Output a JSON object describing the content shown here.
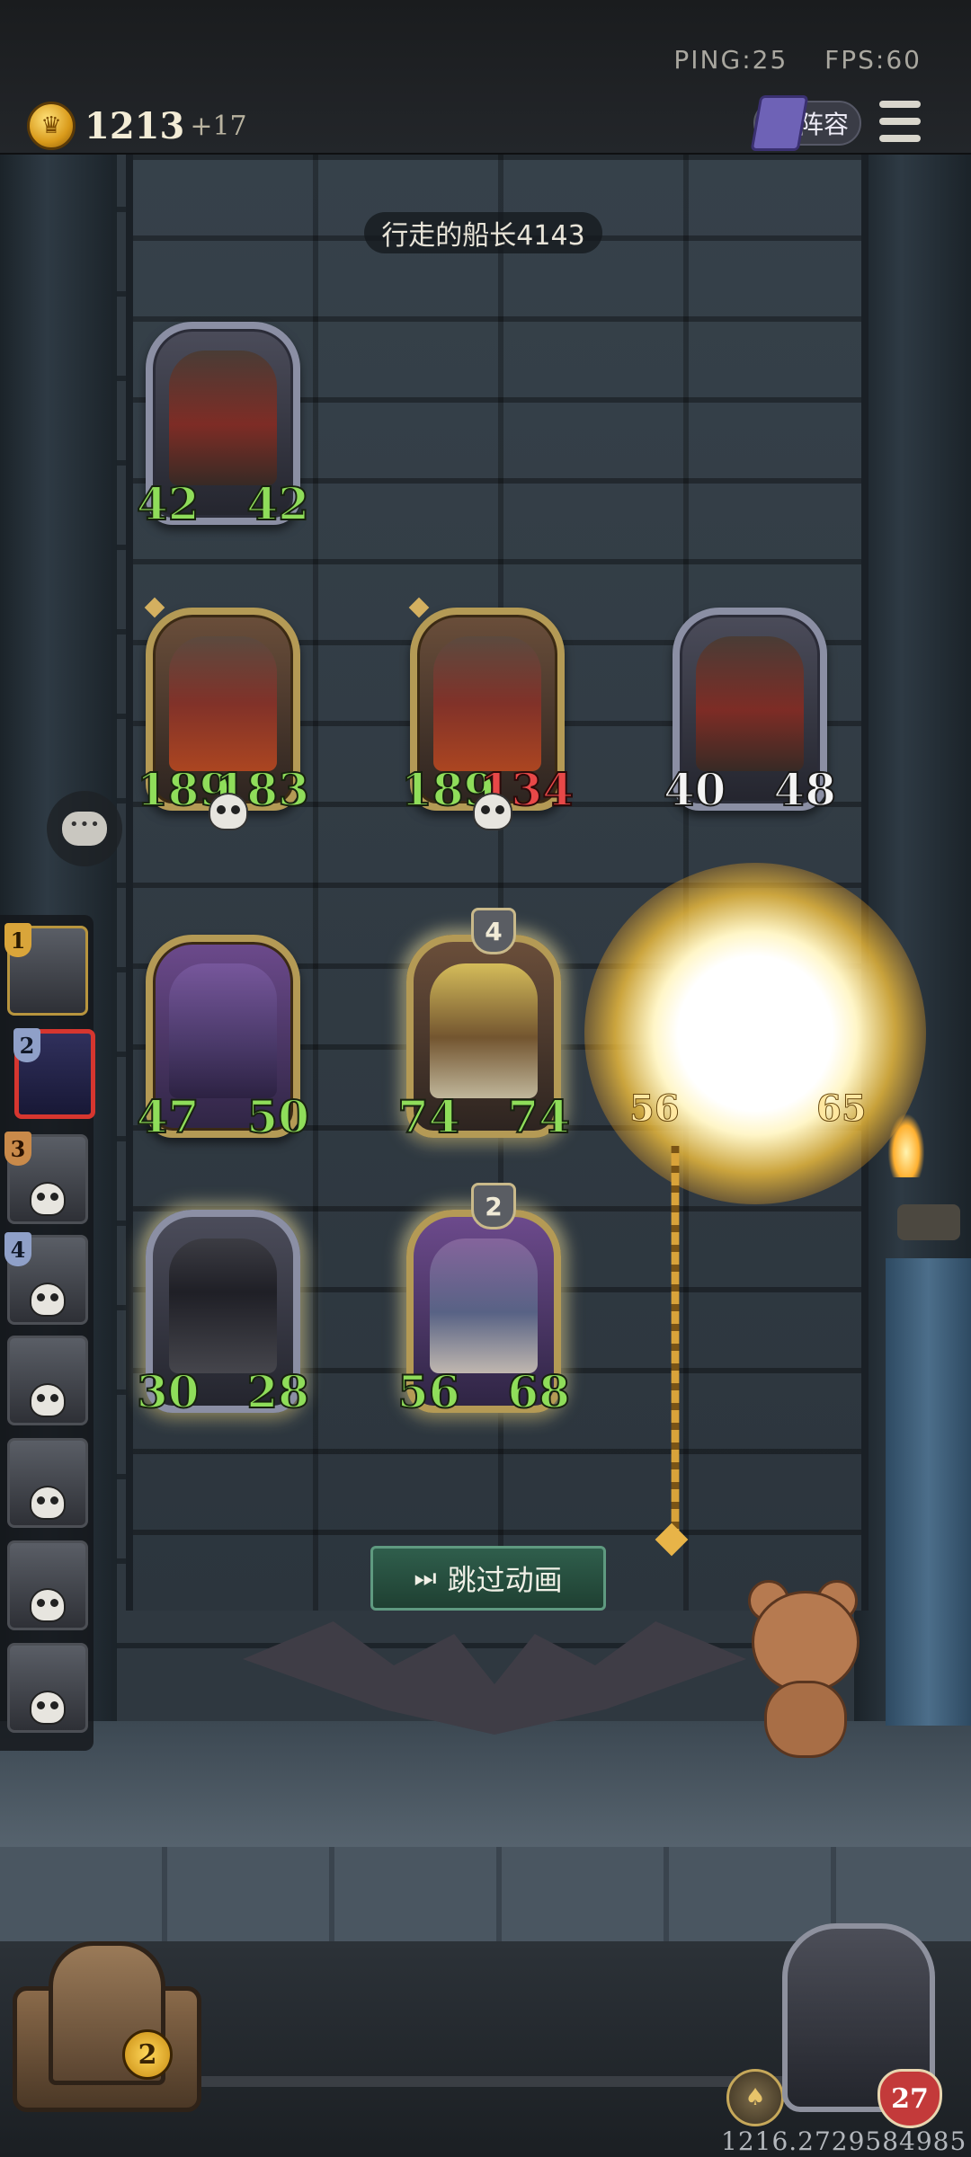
{
  "network": {
    "ping": "PING:25",
    "fps": "FPS:60"
  },
  "player": {
    "gold": "1213",
    "gold_income": "+17",
    "hero_health": "27"
  },
  "buttons": {
    "lineup": "阵容",
    "skip_animation": "跳过动画"
  },
  "opponent": {
    "name": "行走的船长4143"
  },
  "opponent_board": [
    {
      "attack": "42",
      "health": "42",
      "style": "silver",
      "tier": ""
    },
    {
      "attack": "189",
      "health": "183",
      "style": "gold",
      "tier": "",
      "dead": true
    },
    {
      "attack": "189",
      "health": "134",
      "style": "gold",
      "tier": "",
      "dead": true,
      "damaged": true
    },
    {
      "attack": "40",
      "health": "48",
      "style": "silver",
      "tier": ""
    }
  ],
  "player_board": [
    {
      "attack": "47",
      "health": "50",
      "style": "gold",
      "tier": ""
    },
    {
      "attack": "74",
      "health": "74",
      "style": "gold",
      "tier": "4"
    },
    {
      "attack": "56",
      "health": "65",
      "style": "effect",
      "tier": ""
    },
    {
      "attack": "30",
      "health": "28",
      "style": "silver",
      "tier": ""
    },
    {
      "attack": "56",
      "health": "68",
      "style": "gold",
      "tier": "2"
    }
  ],
  "tavern": {
    "level": "2"
  },
  "players_sidebar": [
    {
      "rank": "1",
      "state": "alive",
      "rank_color": "#d9a53a"
    },
    {
      "rank": "2",
      "state": "current",
      "rank_color": "#8fa0c8"
    },
    {
      "rank": "3",
      "state": "dead",
      "rank_color": "#c98a4a"
    },
    {
      "rank": "4",
      "state": "dead",
      "rank_color": "#8fa0c8"
    },
    {
      "rank": "",
      "state": "dead"
    },
    {
      "rank": "",
      "state": "dead"
    },
    {
      "rank": "",
      "state": "dead"
    },
    {
      "rank": "",
      "state": "dead"
    }
  ],
  "seed": "1216.2729584985",
  "colors": {
    "stat_green": "#8fdd5a",
    "stat_red": "#e84848",
    "skip_button": "#2f5e4c"
  },
  "icons": [
    "coin-icon",
    "book-icon",
    "menu-icon",
    "chat-icon",
    "skip-icon",
    "skull-icon",
    "heart-icon",
    "hero-power-icon"
  ]
}
